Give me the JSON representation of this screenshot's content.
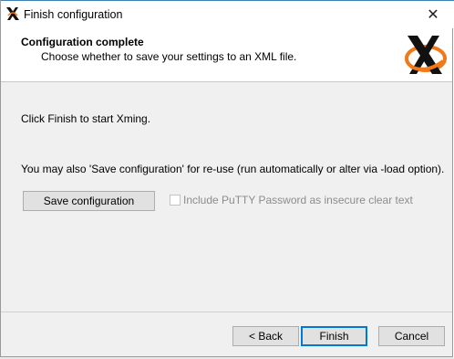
{
  "window": {
    "title": "Finish configuration",
    "close_glyph": "✕"
  },
  "header": {
    "title": "Configuration complete",
    "subtitle": "Choose whether to save your settings to an XML file.",
    "logo_icon": "xming-x-logo"
  },
  "body": {
    "line1": "Click Finish to start Xming.",
    "line2": "You may also 'Save configuration' for re-use (run automatically or alter via -load option).",
    "save_button": "Save configuration",
    "checkbox": {
      "label": "Include PuTTY Password as insecure clear text",
      "checked": false,
      "enabled": false
    }
  },
  "footer": {
    "back_label": "< Back",
    "finish_label": "Finish",
    "cancel_label": "Cancel"
  },
  "colors": {
    "accent": "#0078d7",
    "logo_orange": "#f07a1a"
  }
}
